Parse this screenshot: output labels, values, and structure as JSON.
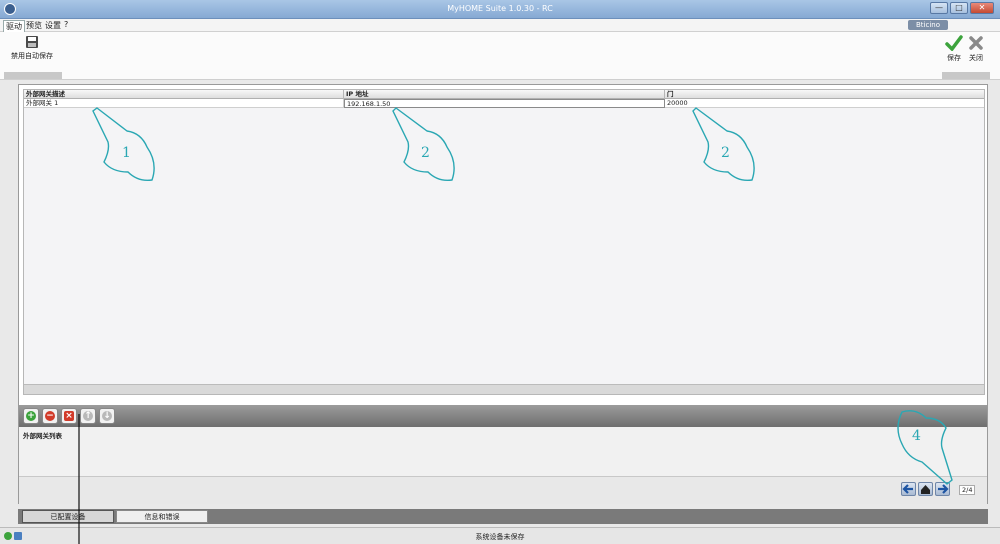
{
  "window": {
    "title": "MyHOME Suite 1.0.30 - RC",
    "controls": [
      "—",
      "□",
      "✕"
    ]
  },
  "menu": [
    "驱动",
    "预览",
    "设置",
    "?"
  ],
  "brand": "Bticino",
  "toolbar": {
    "disable_autosave_label": "禁用自动保存",
    "save_label": "保存",
    "close_label": "关闭"
  },
  "table": {
    "columns": [
      "外部网关描述",
      "IP 地址",
      "门"
    ],
    "rows": [
      {
        "description": "外部网关 1",
        "ip": "192.168.1.50",
        "port": "20000"
      }
    ]
  },
  "list_panel": {
    "label": "外部网关列表"
  },
  "pagination": {
    "indicator": "2/4"
  },
  "tabs": [
    "已配置设备",
    "信息和错误"
  ],
  "status": {
    "message": "系统设备未保存"
  },
  "callouts": [
    "1",
    "2",
    "2",
    "4"
  ],
  "colors": {
    "accent": "#2aa7b3",
    "titlebar": "#86a9d3",
    "add": "#3ca33c",
    "delete": "#d23b2a"
  }
}
